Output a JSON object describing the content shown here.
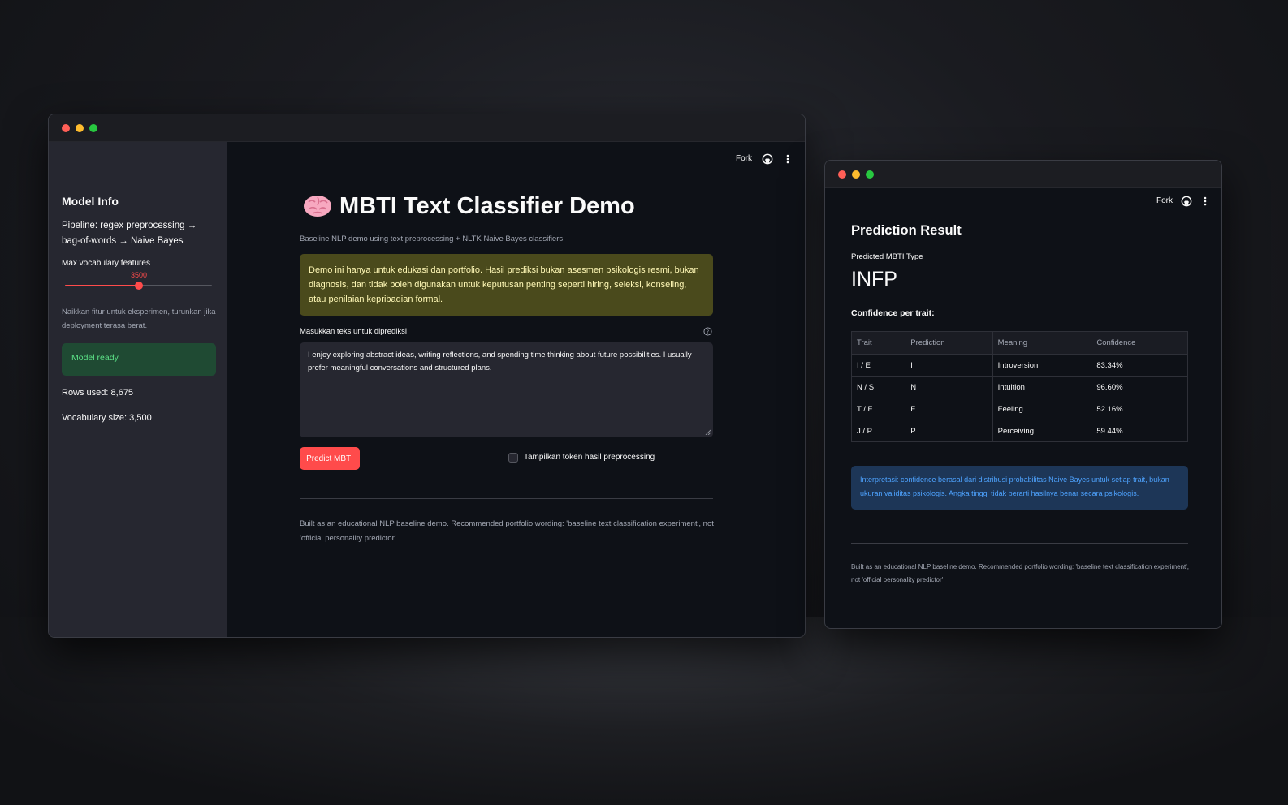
{
  "main_window": {
    "sidebar": {
      "title": "Model Info",
      "pipeline": "Pipeline: regex preprocessing → bag-of-words → Naive Bayes",
      "slider_label": "Max vocabulary features",
      "slider_value": "3500",
      "slider_fraction": 0.5,
      "hint": "Naikkan fitur untuk eksperimen, turunkan jika deployment terasa berat.",
      "status": "Model ready",
      "rows_used": "Rows used: 8,675",
      "vocab_size": "Vocabulary size: 3,500"
    },
    "toolbar": {
      "fork_label": "Fork",
      "github_icon": "github-icon",
      "menu_icon": "kebab-menu-icon"
    },
    "header": {
      "icon": "brain-icon",
      "title": "MBTI Text Classifier Demo",
      "subtitle": "Baseline NLP demo using text preprocessing + NLTK Naive Bayes classifiers"
    },
    "warning": "Demo ini hanya untuk edukasi dan portfolio. Hasil prediksi bukan asesmen psikologis resmi, bukan diagnosis, dan tidak boleh digunakan untuk keputusan penting seperti hiring, seleksi, konseling, atau penilaian kepribadian formal.",
    "input": {
      "label": "Masukkan teks untuk diprediksi",
      "value": "I enjoy exploring abstract ideas, writing reflections, and spending time thinking about future possibilities. I usually prefer meaningful conversations and structured plans."
    },
    "predict_button": "Predict MBTI",
    "checkbox_label": "Tampilkan token hasil preprocessing",
    "footer": "Built as an educational NLP baseline demo. Recommended portfolio wording: 'baseline text classification experiment', not 'official personality predictor'."
  },
  "result_window": {
    "toolbar": {
      "fork_label": "Fork"
    },
    "title": "Prediction Result",
    "predicted_label": "Predicted MBTI Type",
    "predicted_value": "INFP",
    "confidence_label": "Confidence per trait:",
    "table": {
      "headers": [
        "Trait",
        "Prediction",
        "Meaning",
        "Confidence"
      ],
      "rows": [
        [
          "I / E",
          "I",
          "Introversion",
          "83.34%"
        ],
        [
          "N / S",
          "N",
          "Intuition",
          "96.60%"
        ],
        [
          "T / F",
          "F",
          "Feeling",
          "52.16%"
        ],
        [
          "J / P",
          "P",
          "Perceiving",
          "59.44%"
        ]
      ]
    },
    "interpretation": "Interpretasi: confidence berasal dari distribusi probabilitas Naive Bayes untuk setiap trait, bukan ukuran validitas psikologis. Angka tinggi tidak berarti hasilnya benar secara psikologis.",
    "footer": "Built as an educational NLP baseline demo. Recommended portfolio wording: 'baseline text classification experiment', not 'official personality predictor'."
  },
  "colors": {
    "accent": "#ff4b4b",
    "success_bg": "#1f4a33",
    "warning_bg": "#4a4a1c",
    "info_bg": "#1d3657"
  }
}
